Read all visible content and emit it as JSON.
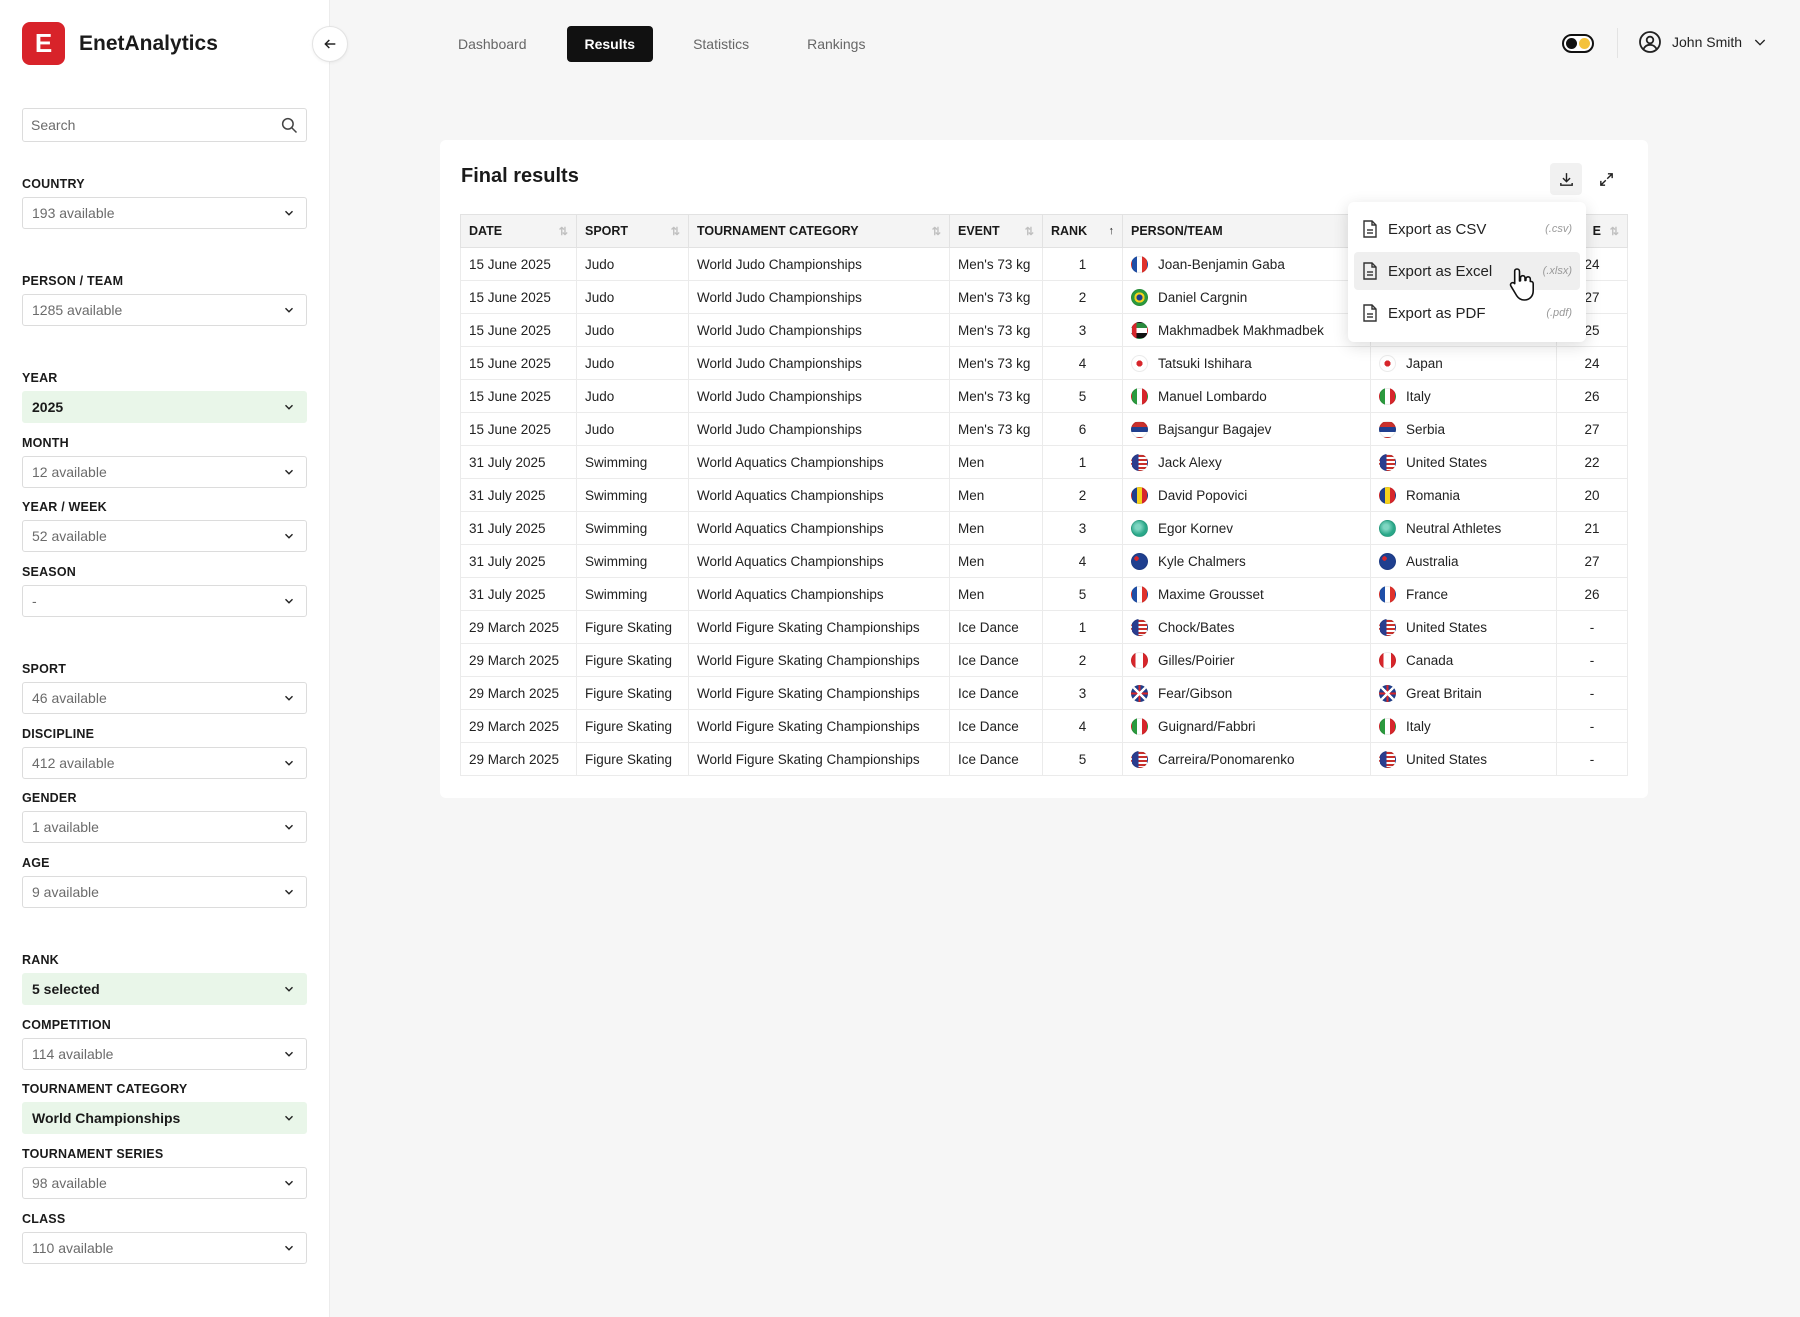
{
  "app": {
    "logo_letter": "E",
    "name": "EnetAnalytics"
  },
  "sidebar": {
    "search_placeholder": "Search",
    "filters": [
      {
        "label": "COUNTRY",
        "value": "193 available",
        "active": false
      },
      {
        "label": "PERSON / TEAM",
        "value": "1285 available",
        "active": false
      },
      {
        "label": "YEAR",
        "value": "2025",
        "active": true
      },
      {
        "label": "MONTH",
        "value": "12 available",
        "active": false
      },
      {
        "label": "YEAR / WEEK",
        "value": "52 available",
        "active": false
      },
      {
        "label": "SEASON",
        "value": "-",
        "active": false
      },
      {
        "label": "SPORT",
        "value": "46 available",
        "active": false
      },
      {
        "label": "DISCIPLINE",
        "value": "412 available",
        "active": false
      },
      {
        "label": "GENDER",
        "value": "1 available",
        "active": false
      },
      {
        "label": "AGE",
        "value": "9 available",
        "active": false
      },
      {
        "label": "RANK",
        "value": "5 selected",
        "active": true
      },
      {
        "label": "COMPETITION",
        "value": "114 available",
        "active": false
      },
      {
        "label": "TOURNAMENT CATEGORY",
        "value": "World Championships",
        "active": true
      },
      {
        "label": "TOURNAMENT SERIES",
        "value": "98 available",
        "active": false
      },
      {
        "label": "CLASS",
        "value": "110 available",
        "active": false
      }
    ]
  },
  "nav": {
    "tabs": [
      {
        "label": "Dashboard",
        "active": false
      },
      {
        "label": "Results",
        "active": true
      },
      {
        "label": "Statistics",
        "active": false
      },
      {
        "label": "Rankings",
        "active": false
      }
    ]
  },
  "user": {
    "name": "John Smith"
  },
  "card": {
    "title": "Final results",
    "columns": [
      "DATE",
      "SPORT",
      "TOURNAMENT CATEGORY",
      "EVENT",
      "RANK",
      "PERSON/TEAM",
      "",
      "E"
    ],
    "rows": [
      {
        "date": "15 June 2025",
        "sport": "Judo",
        "category": "World Judo Championships",
        "event": "Men's 73 kg",
        "rank": "1",
        "person": "Joan-Benjamin Gaba",
        "person_flag": "france",
        "country": "",
        "country_flag": "",
        "age": "24"
      },
      {
        "date": "15 June 2025",
        "sport": "Judo",
        "category": "World Judo Championships",
        "event": "Men's 73 kg",
        "rank": "2",
        "person": "Daniel Cargnin",
        "person_flag": "brazil",
        "country": "",
        "country_flag": "",
        "age": "27"
      },
      {
        "date": "15 June 2025",
        "sport": "Judo",
        "category": "World Judo Championships",
        "event": "Men's 73 kg",
        "rank": "3",
        "person": "Makhmadbek Makhmadbek",
        "person_flag": "uae",
        "country": "",
        "country_flag": "",
        "age": "25"
      },
      {
        "date": "15 June 2025",
        "sport": "Judo",
        "category": "World Judo Championships",
        "event": "Men's 73 kg",
        "rank": "4",
        "person": "Tatsuki Ishihara",
        "person_flag": "japan",
        "country": "Japan",
        "country_flag": "japan",
        "age": "24"
      },
      {
        "date": "15 June 2025",
        "sport": "Judo",
        "category": "World Judo Championships",
        "event": "Men's 73 kg",
        "rank": "5",
        "person": "Manuel Lombardo",
        "person_flag": "italy",
        "country": "Italy",
        "country_flag": "italy",
        "age": "26"
      },
      {
        "date": "15 June 2025",
        "sport": "Judo",
        "category": "World Judo Championships",
        "event": "Men's 73 kg",
        "rank": "6",
        "person": "Bajsangur Bagajev",
        "person_flag": "serbia",
        "country": "Serbia",
        "country_flag": "serbia",
        "age": "27"
      },
      {
        "date": "31 July 2025",
        "sport": "Swimming",
        "category": "World Aquatics Championships",
        "event": "Men",
        "rank": "1",
        "person": "Jack Alexy",
        "person_flag": "usa",
        "country": "United States",
        "country_flag": "usa",
        "age": "22"
      },
      {
        "date": "31 July 2025",
        "sport": "Swimming",
        "category": "World Aquatics Championships",
        "event": "Men",
        "rank": "2",
        "person": "David Popovici",
        "person_flag": "romania",
        "country": "Romania",
        "country_flag": "romania",
        "age": "20"
      },
      {
        "date": "31 July 2025",
        "sport": "Swimming",
        "category": "World Aquatics Championships",
        "event": "Men",
        "rank": "3",
        "person": "Egor Kornev",
        "person_flag": "neutral",
        "country": "Neutral Athletes",
        "country_flag": "neutral",
        "age": "21"
      },
      {
        "date": "31 July 2025",
        "sport": "Swimming",
        "category": "World Aquatics Championships",
        "event": "Men",
        "rank": "4",
        "person": "Kyle Chalmers",
        "person_flag": "australia",
        "country": "Australia",
        "country_flag": "australia",
        "age": "27"
      },
      {
        "date": "31 July 2025",
        "sport": "Swimming",
        "category": "World Aquatics Championships",
        "event": "Men",
        "rank": "5",
        "person": "Maxime Grousset",
        "person_flag": "france",
        "country": "France",
        "country_flag": "france",
        "age": "26"
      },
      {
        "date": "29 March 2025",
        "sport": "Figure Skating",
        "category": "World Figure Skating Championships",
        "event": "Ice Dance",
        "rank": "1",
        "person": "Chock/Bates",
        "person_flag": "usa",
        "country": "United States",
        "country_flag": "usa",
        "age": "-"
      },
      {
        "date": "29 March 2025",
        "sport": "Figure Skating",
        "category": "World Figure Skating Championships",
        "event": "Ice Dance",
        "rank": "2",
        "person": "Gilles/Poirier",
        "person_flag": "canada",
        "country": "Canada",
        "country_flag": "canada",
        "age": "-"
      },
      {
        "date": "29 March 2025",
        "sport": "Figure Skating",
        "category": "World Figure Skating Championships",
        "event": "Ice Dance",
        "rank": "3",
        "person": "Fear/Gibson",
        "person_flag": "gb",
        "country": "Great Britain",
        "country_flag": "gb",
        "age": "-"
      },
      {
        "date": "29 March 2025",
        "sport": "Figure Skating",
        "category": "World Figure Skating Championships",
        "event": "Ice Dance",
        "rank": "4",
        "person": "Guignard/Fabbri",
        "person_flag": "italy",
        "country": "Italy",
        "country_flag": "italy",
        "age": "-"
      },
      {
        "date": "29 March 2025",
        "sport": "Figure Skating",
        "category": "World Figure Skating Championships",
        "event": "Ice Dance",
        "rank": "5",
        "person": "Carreira/Ponomarenko",
        "person_flag": "usa",
        "country": "United States",
        "country_flag": "usa",
        "age": "-"
      }
    ]
  },
  "export_menu": {
    "items": [
      {
        "label": "Export as CSV",
        "ext": "(.csv)",
        "hover": false
      },
      {
        "label": "Export as Excel",
        "ext": "(.xlsx)",
        "hover": true
      },
      {
        "label": "Export as PDF",
        "ext": "(.pdf)",
        "hover": false
      }
    ]
  },
  "colors": {
    "brand": "#d8232a",
    "active_filter_bg": "#e9f6e9",
    "active_tab_bg": "#111111"
  },
  "flags": {
    "france": "linear-gradient(90deg,#1f4fa8 33%,#ffffff 33%,#ffffff 66%,#e0312c 66%)",
    "brazil": "radial-gradient(circle,#1f3f8f 28%,#f6d21d 29%,#f6d21d 48%,#2b9a3e 49%)",
    "uae": "linear-gradient(90deg,#d7262b 30%,transparent 30%),linear-gradient(180deg,#2b8a3e 33%,#ffffff 33%,#ffffff 66%,#111111 66%)",
    "japan": "radial-gradient(circle,#d7262b 28%,#ffffff 30%)",
    "italy": "linear-gradient(90deg,#2b9a3e 33%,#ffffff 33%,#ffffff 66%,#d7262b 66%)",
    "serbia": "linear-gradient(180deg,#c9302c 33%,#1f3f8f 33%,#1f3f8f 66%,#ffffff 66%)",
    "usa": "linear-gradient(90deg,#2a3d8f 45%,transparent 45%),repeating-linear-gradient(180deg,#c9302c 0 2px,#ffffff 2px 4px)",
    "romania": "linear-gradient(90deg,#1f3f8f 33%,#f6d21d 33%,#f6d21d 66%,#d7262b 66%)",
    "neutral": "radial-gradient(circle at 40% 40%,#7fd6c2 20%,#2aa889 60%)",
    "australia": "radial-gradient(circle at 30% 30%,#d7262b 15%,transparent 16%),linear-gradient(180deg,#1f3f8f,#1f3f8f)",
    "canada": "linear-gradient(90deg,#d7262b 25%,#ffffff 25%,#ffffff 75%,#d7262b 75%)",
    "gb": "linear-gradient(45deg,transparent 44%,#ffffff 44%,#ffffff 56%,transparent 56%),linear-gradient(-45deg,transparent 44%,#ffffff 44%,#ffffff 56%,transparent 56%),linear-gradient(90deg,transparent 42%,#d7262b 42%,#d7262b 58%,transparent 58%),linear-gradient(180deg,transparent 42%,#d7262b 42%,#d7262b 58%,transparent 58%),linear-gradient(#1f3f8f,#1f3f8f)"
  }
}
